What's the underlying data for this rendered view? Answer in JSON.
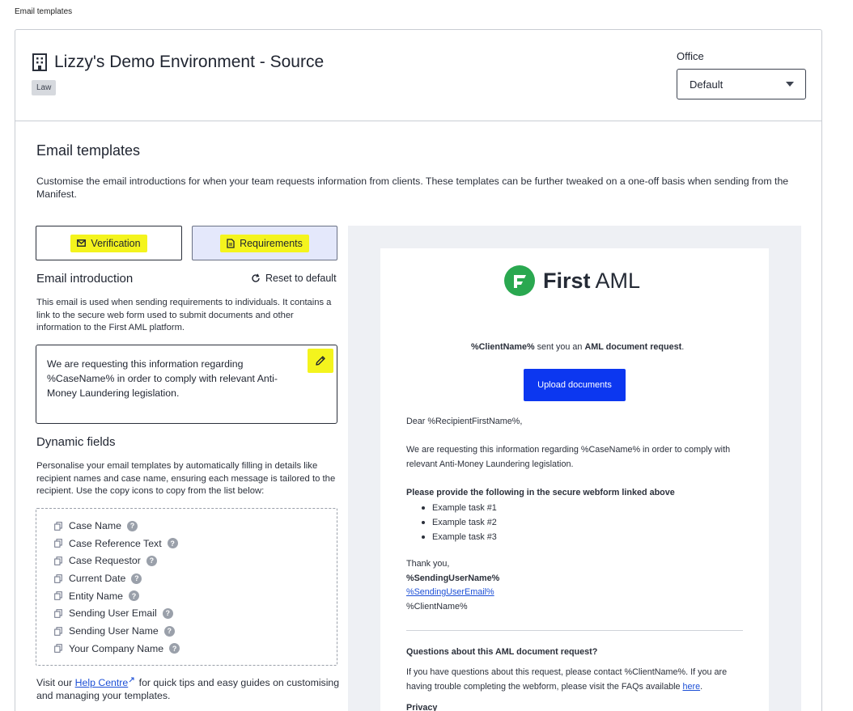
{
  "breadcrumb": "Email templates",
  "header": {
    "environment_name": "Lizzy's Demo Environment - Source",
    "badge": "Law",
    "office_label": "Office",
    "office_value": "Default"
  },
  "section": {
    "title": "Email templates",
    "description": "Customise the email introductions for when your team requests information from clients. These templates can be further tweaked on a one-off basis when sending from the Manifest."
  },
  "tabs": {
    "verification": "Verification",
    "requirements": "Requirements"
  },
  "intro": {
    "title": "Email introduction",
    "reset_label": "Reset to default",
    "description": "This email is used when sending requirements to individuals. It contains a link to the secure web form used to submit documents and other information to the First AML platform.",
    "text": "We are requesting this information regarding %CaseName% in order to comply with relevant Anti-Money Laundering legislation."
  },
  "dynamic": {
    "title": "Dynamic fields",
    "description": "Personalise your email templates by automatically filling in details like recipient names and case name, ensuring each message is tailored to the recipient. Use the copy icons to copy from the list below:",
    "fields": [
      "Case Name",
      "Case Reference Text",
      "Case Requestor",
      "Current Date",
      "Entity Name",
      "Sending User Email",
      "Sending User Name",
      "Your Company Name"
    ]
  },
  "help": {
    "prefix": "Visit our ",
    "link": "Help Centre",
    "suffix": " for quick tips and easy guides on customising and managing your templates."
  },
  "preview": {
    "brand_bold": "First",
    "brand_light": " AML",
    "request_client": "%ClientName%",
    "request_mid": " sent you an ",
    "request_bold": "AML document request",
    "request_end": ".",
    "upload_button": "Upload documents",
    "greeting": "Dear %RecipientFirstName%,",
    "body_line1": "We are requesting this information regarding %CaseName% in order to comply with",
    "body_line2": "relevant Anti-Money Laundering legislation.",
    "provide_heading": "Please provide the following in the secure webform linked above",
    "tasks": [
      "Example task #1",
      "Example task #2",
      "Example task #3"
    ],
    "thanks": "Thank you,",
    "sender_name": "%SendingUserName%",
    "sender_email": "%SendingUserEmail%",
    "client_name": "%ClientName%",
    "questions_heading": "Questions about this AML document request?",
    "questions_line1": "If you have questions about this request, please contact %ClientName%. If you are",
    "questions_line2_prefix": "having trouble completing the webform, please visit the FAQs available ",
    "questions_link": "here",
    "questions_line2_suffix": ".",
    "privacy_heading": "Privacy"
  },
  "colors": {
    "highlight": "#f4f41d",
    "primary_button": "#0c37f0",
    "brand_green": "#2aa850",
    "link": "#1c4fd6"
  },
  "icons": [
    "building-icon",
    "envelope-icon",
    "document-icon",
    "reset-icon",
    "pencil-icon",
    "copy-icon",
    "help-icon",
    "external-link-icon",
    "first-aml-logo-icon",
    "caret-down-icon"
  ]
}
